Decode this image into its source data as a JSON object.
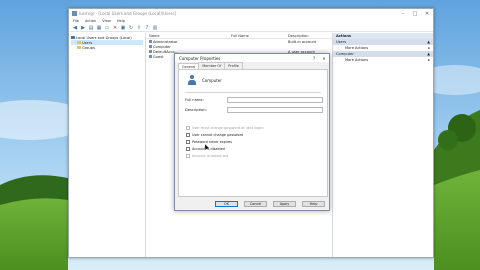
{
  "window": {
    "title": "lusrmgr - [Local Users and Groups (Local)\\Users]",
    "menu": [
      "File",
      "Action",
      "View",
      "Help"
    ]
  },
  "tree": {
    "root": "Local Users and Groups (Local)",
    "children": [
      "Users",
      "Groups"
    ]
  },
  "list": {
    "headers": [
      "Name",
      "Full Name",
      "Description"
    ],
    "rows": [
      {
        "name": "Administrator",
        "full_name": "",
        "description": "Built-in account"
      },
      {
        "name": "Computer",
        "full_name": "",
        "description": ""
      },
      {
        "name": "DefaultAcco...",
        "full_name": "",
        "description": "A user account"
      },
      {
        "name": "Guest",
        "full_name": "",
        "description": "Built-in account"
      }
    ]
  },
  "actions": {
    "header": "Actions",
    "sections": [
      {
        "title": "Users",
        "items": [
          "More Actions"
        ]
      },
      {
        "title": "Computer",
        "items": [
          "More Actions"
        ]
      }
    ]
  },
  "dialog": {
    "title": "Computer Properties",
    "help": "?",
    "close": "✕",
    "tabs": [
      "General",
      "Member Of",
      "Profile"
    ],
    "username": "Computer",
    "full_name_label": "Full name:",
    "full_name_value": "",
    "description_label": "Description:",
    "description_value": "",
    "checkboxes": [
      {
        "label": "User must change password at next logon",
        "disabled": true
      },
      {
        "label": "User cannot change password",
        "disabled": false
      },
      {
        "label": "Password never expires",
        "disabled": false
      },
      {
        "label": "Account is disabled",
        "disabled": false
      },
      {
        "label": "Account is locked out",
        "disabled": true
      }
    ],
    "buttons": {
      "ok": "OK",
      "cancel": "Cancel",
      "apply": "Apply",
      "help": "Help"
    }
  },
  "colors": {
    "accent": "#0078d7",
    "selection": "#cce8ff",
    "actions_header": "#dbe6f2"
  }
}
